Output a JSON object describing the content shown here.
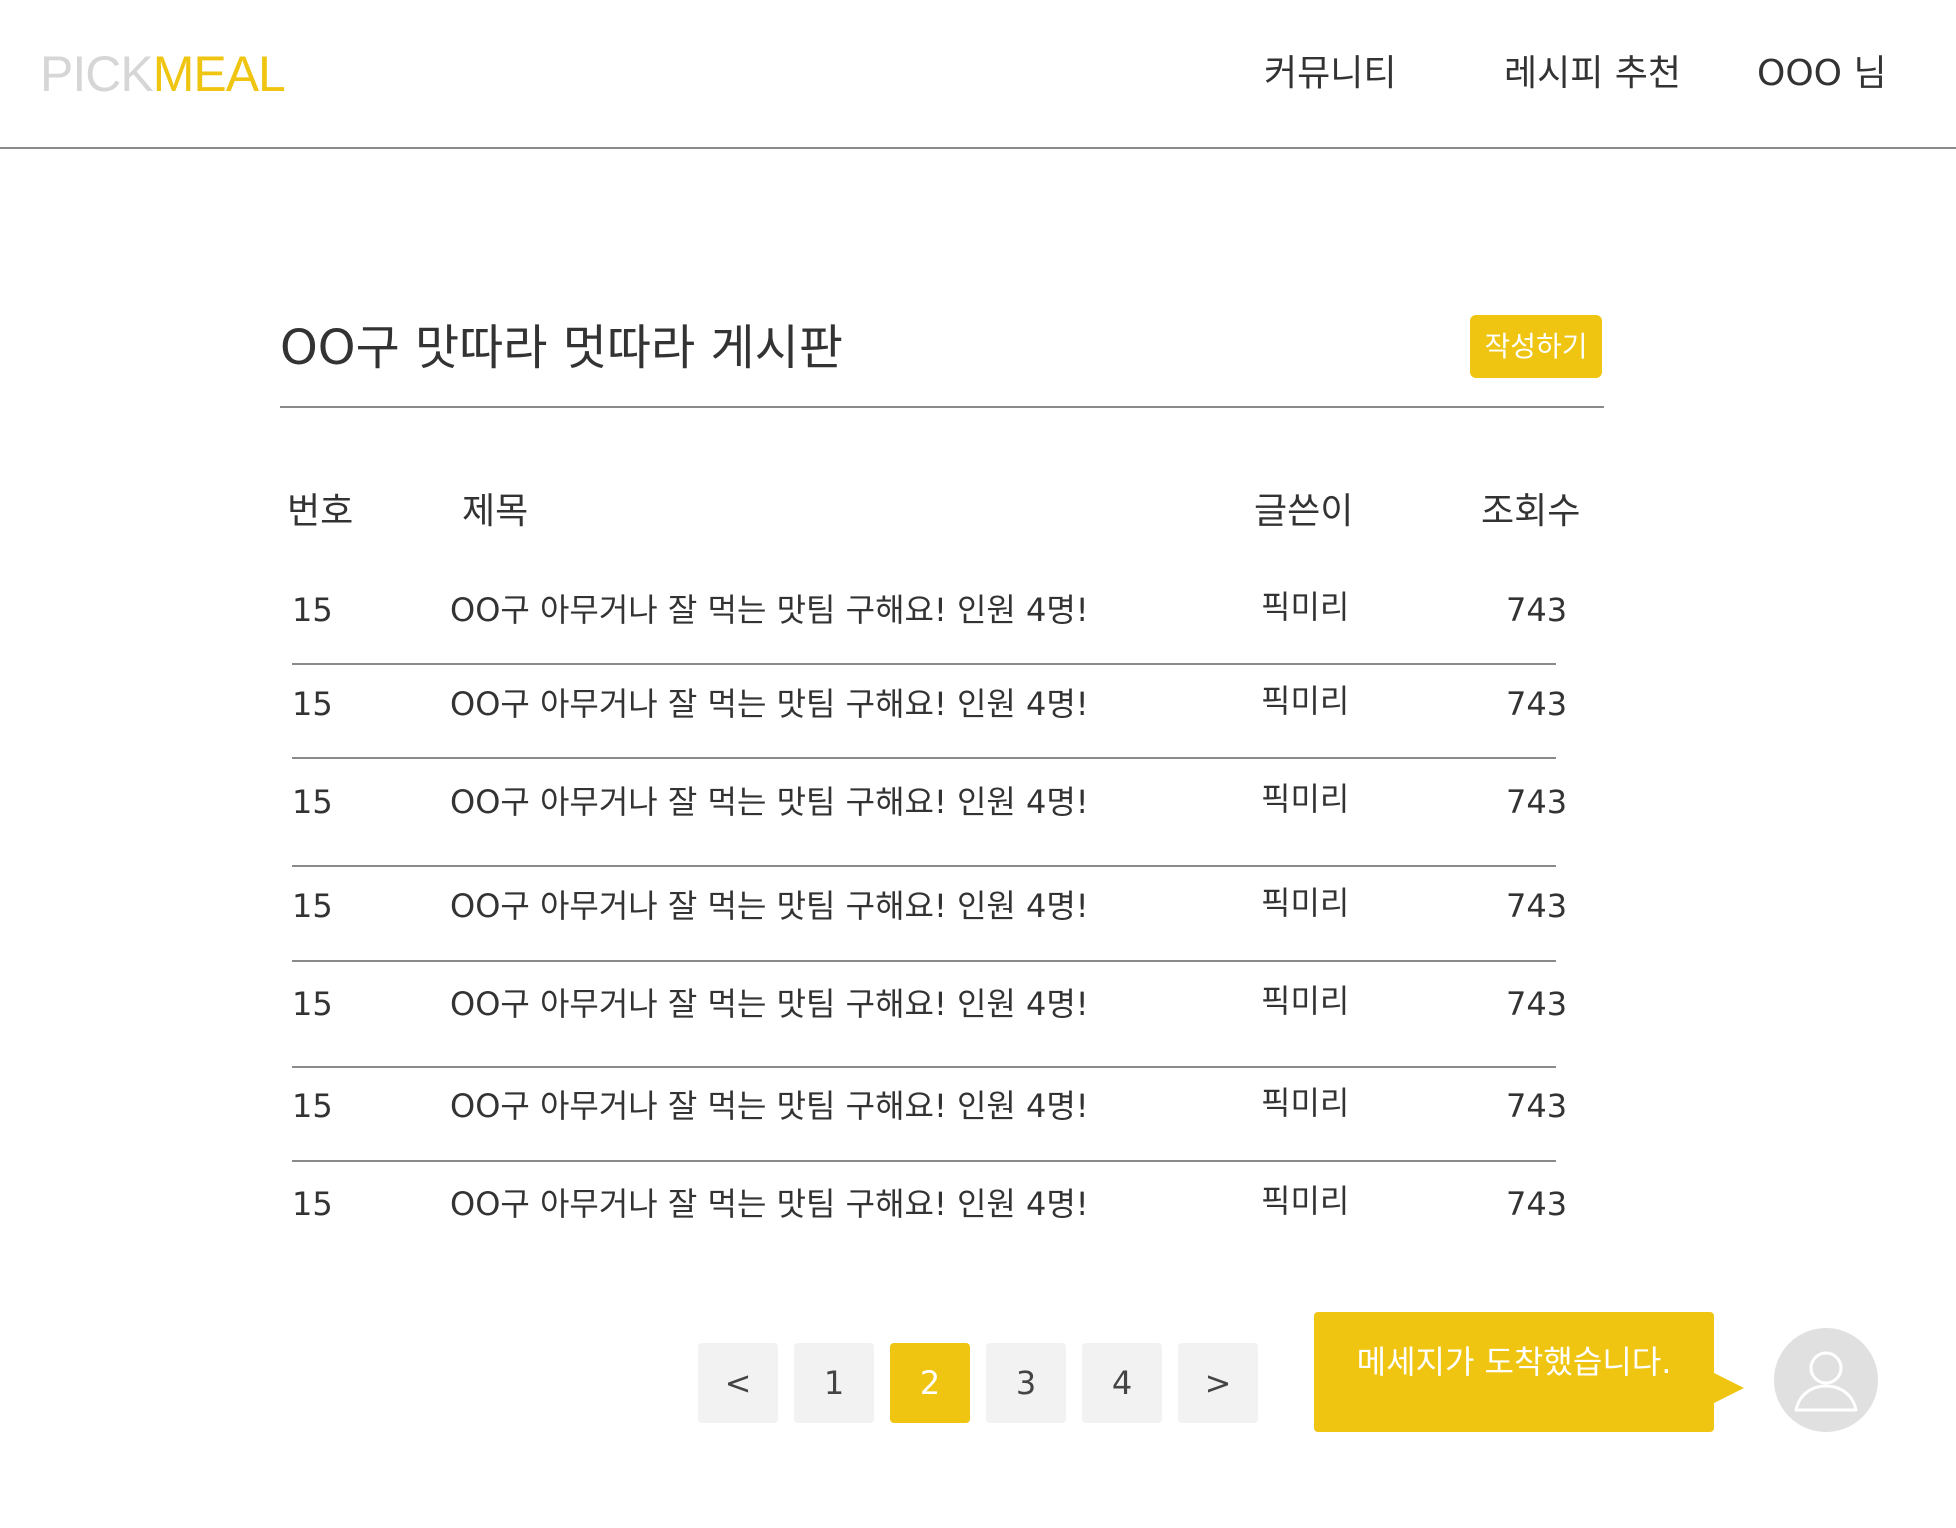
{
  "header": {
    "logo": {
      "part1": "PICK",
      "part2": "MEAL"
    },
    "nav": {
      "community": "커뮤니티",
      "recipe": "레시피 추천",
      "user": "OOO 님"
    }
  },
  "board": {
    "title": "OO구 맛따라 멋따라 게시판",
    "write_button": "작성하기",
    "columns": {
      "number": "번호",
      "title": "제목",
      "writer": "글쓴이",
      "views": "조회수"
    },
    "rows": [
      {
        "number": "15",
        "title": "OO구 아무거나 잘 먹는 맛팀 구해요! 인원 4명!",
        "writer": "픽미리",
        "views": "743"
      },
      {
        "number": "15",
        "title": "OO구 아무거나 잘 먹는 맛팀 구해요! 인원 4명!",
        "writer": "픽미리",
        "views": "743"
      },
      {
        "number": "15",
        "title": "OO구 아무거나 잘 먹는 맛팀 구해요! 인원 4명!",
        "writer": "픽미리",
        "views": "743"
      },
      {
        "number": "15",
        "title": "OO구 아무거나 잘 먹는 맛팀 구해요! 인원 4명!",
        "writer": "픽미리",
        "views": "743"
      },
      {
        "number": "15",
        "title": "OO구 아무거나 잘 먹는 맛팀 구해요! 인원 4명!",
        "writer": "픽미리",
        "views": "743"
      },
      {
        "number": "15",
        "title": "OO구 아무거나 잘 먹는 맛팀 구해요! 인원 4명!",
        "writer": "픽미리",
        "views": "743"
      },
      {
        "number": "15",
        "title": "OO구 아무거나 잘 먹는 맛팀 구해요! 인원 4명!",
        "writer": "픽미리",
        "views": "743"
      }
    ]
  },
  "pagination": {
    "prev": "<",
    "pages": [
      "1",
      "2",
      "3",
      "4"
    ],
    "current": "2",
    "next": ">"
  },
  "message": {
    "text": "메세지가 도착했습니다.",
    "avatar_icon": "user-avatar-icon"
  },
  "colors": {
    "accent": "#efc511",
    "logo_light": "#d6d6d6",
    "text": "#333333",
    "rule": "#8a8a8a",
    "page_button_bg": "#f2f2f2",
    "avatar_bg": "#e0e0e0"
  }
}
